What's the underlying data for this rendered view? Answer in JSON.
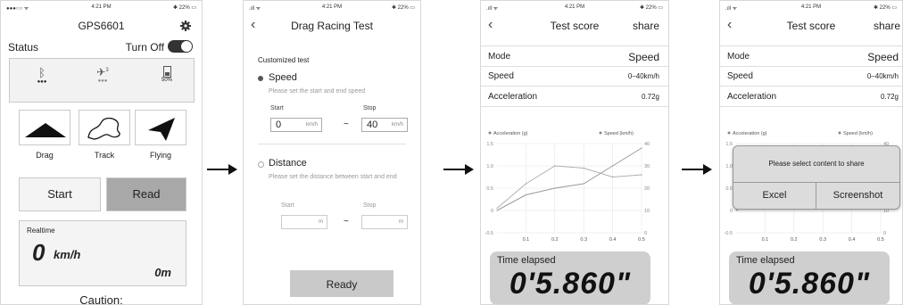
{
  "p1": {
    "status_bar": {
      "left": "●●●○○ ᯤ",
      "time": "4:21 PM",
      "right": "✱ 22% ▭"
    },
    "title": "GPS6601",
    "status_label": "Status",
    "turn_off_label": "Turn Off",
    "status_icons": [
      {
        "icon": "bluetooth-icon",
        "sub": "●●●"
      },
      {
        "icon": "satellite-icon",
        "badge": "3",
        "sub": "●●●"
      },
      {
        "icon": "battery-icon",
        "sub": "50%"
      }
    ],
    "modes": [
      {
        "label": "Drag"
      },
      {
        "label": "Track"
      },
      {
        "label": "Flying"
      }
    ],
    "start_label": "Start",
    "read_label": "Read",
    "realtime_label": "Realtime",
    "speed_value": "0",
    "speed_unit": "km/h",
    "distance_value": "0m",
    "caution": "Caution:"
  },
  "p2": {
    "status_bar": {
      "left": ".ıll ᯤ",
      "time": "4:21 PM",
      "right": "✱ 22% ▭"
    },
    "title": "Drag Racing Test",
    "section": "Customized test",
    "speed_option": "Speed",
    "speed_hint": "Please set the start and end speed",
    "start_label": "Start",
    "stop_label": "Stop",
    "start_value": "0",
    "stop_value": "40",
    "unit": "km/h",
    "tilde": "~",
    "distance_option": "Distance",
    "distance_hint": "Please set the distance between start and end",
    "d_start_label": "Start",
    "d_stop_label": "Stop",
    "d_unit": "m",
    "ready_label": "Ready"
  },
  "p3": {
    "status_bar": {
      "left": ".ıll ᯤ",
      "time": "4:21 PM",
      "right": "✱ 22% ▭"
    },
    "title": "Test score",
    "share": "share",
    "rows": [
      {
        "k": "Mode",
        "v": "Speed"
      },
      {
        "k": "Speed",
        "v": "0–40km/h"
      },
      {
        "k": "Acceleration",
        "v": "0.72g"
      }
    ],
    "elapsed_label": "Time elapsed",
    "elapsed_value": "0'5.860\""
  },
  "p4": {
    "status_bar": {
      "left": ".ıll ᯤ",
      "time": "4:21 PM",
      "right": "✱ 22% ▭"
    },
    "title": "Test score",
    "share": "share",
    "rows": [
      {
        "k": "Mode",
        "v": "Speed"
      },
      {
        "k": "Speed",
        "v": "0–40km/h"
      },
      {
        "k": "Acceleration",
        "v": "0.72g"
      }
    ],
    "dialog_title": "Please select content to share",
    "excel": "Excel",
    "screenshot": "Screenshot",
    "elapsed_label": "Time elapsed",
    "elapsed_value": "0'5.860\""
  },
  "chart_data": {
    "type": "line",
    "legend": [
      "Acceleration (g)",
      "Speed (km/h)"
    ],
    "x": [
      0,
      0.1,
      0.2,
      0.3,
      0.4,
      0.5
    ],
    "x_ticks": [
      "0.1",
      "0.2",
      "0.3",
      "0.4",
      "0.5"
    ],
    "y_left_ticks": [
      "1.5",
      "1.0",
      "0.5",
      "0",
      "-0.5"
    ],
    "y_right_ticks": [
      "40",
      "30",
      "20",
      "10",
      "0"
    ],
    "ylim_left": [
      -0.5,
      1.5
    ],
    "ylim_right": [
      0,
      40
    ],
    "series": [
      {
        "name": "Acceleration (g)",
        "axis": "left",
        "values": [
          0.05,
          0.6,
          1.0,
          0.95,
          0.75,
          0.8
        ]
      },
      {
        "name": "Speed (km/h)",
        "axis": "right",
        "values": [
          10,
          17,
          20,
          22,
          30,
          38
        ]
      }
    ]
  }
}
